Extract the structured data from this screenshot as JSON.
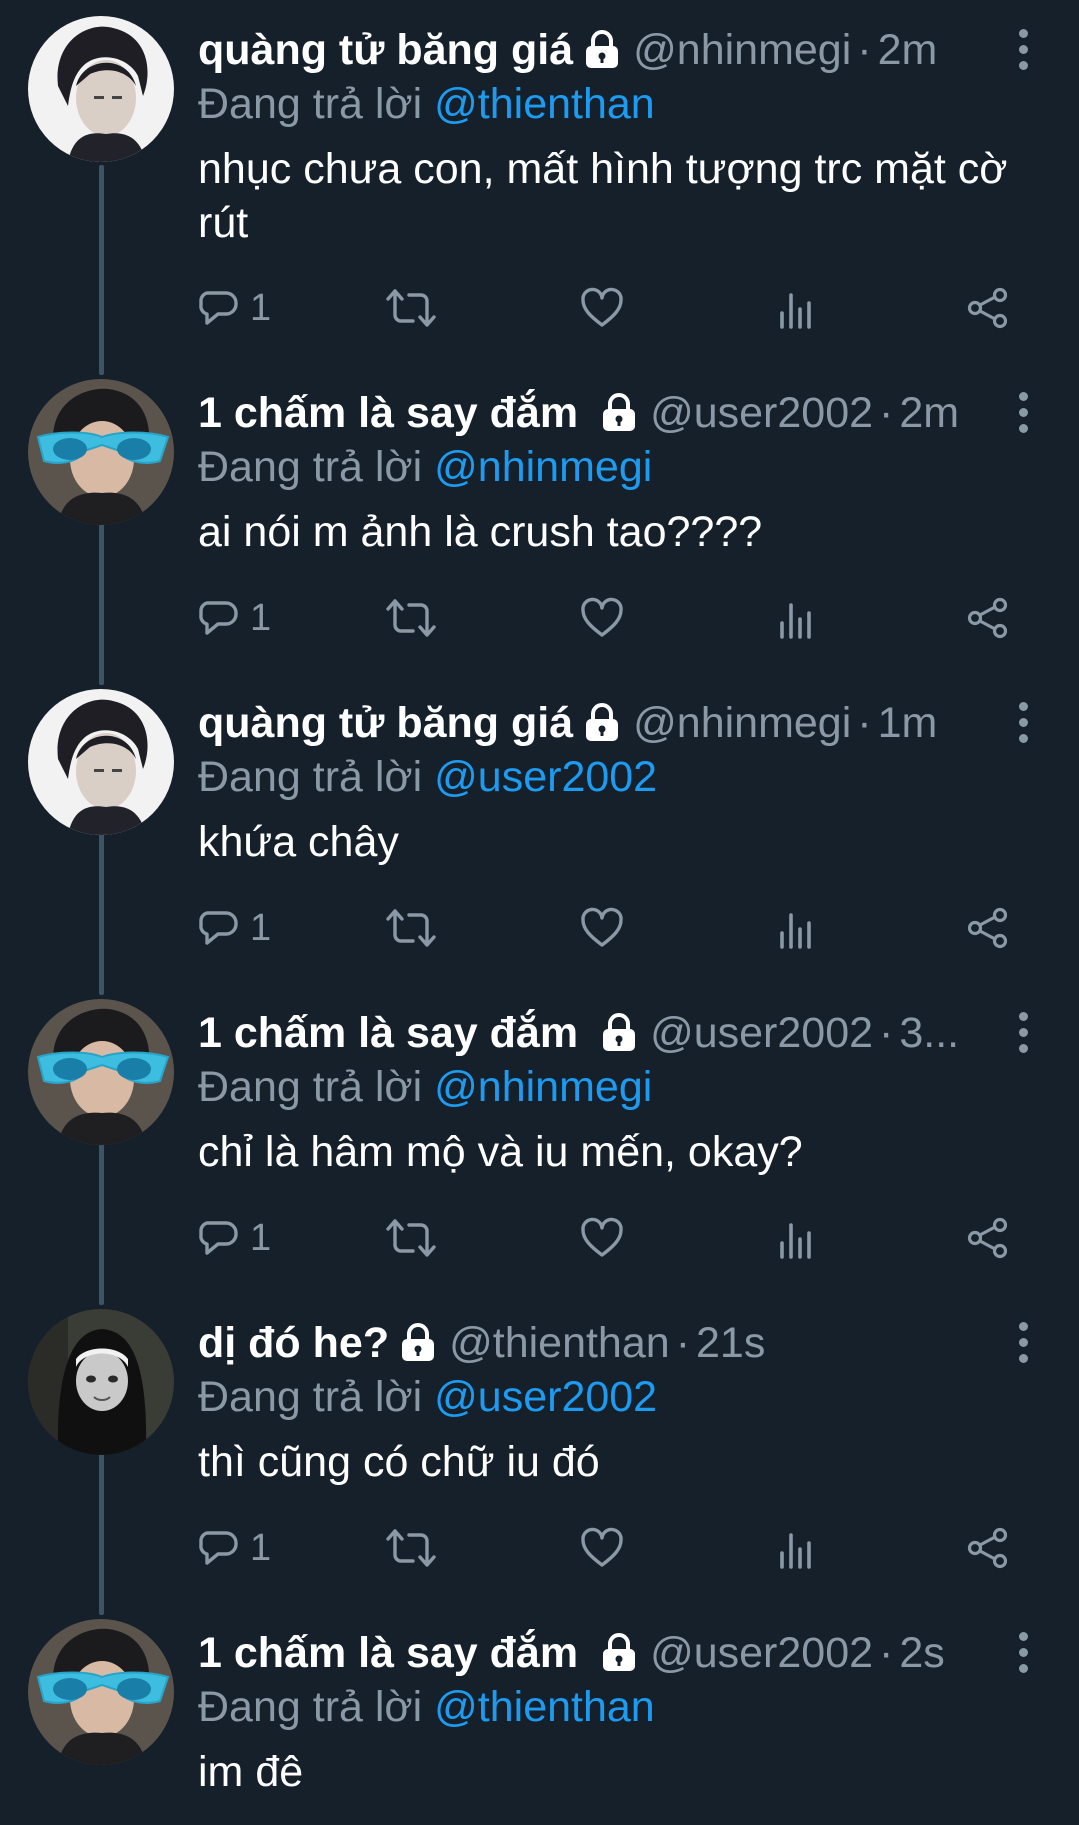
{
  "tweets": [
    {
      "name": "quàng tử băng giá",
      "handle": "@nhinmegi",
      "time": "2m",
      "reply_prefix": "Đang trả lời",
      "reply_to": "@thienthan",
      "text": "nhục chưa con, mất hình tượng trc mặt cờ rút",
      "reply_count": "1",
      "avatar": "avatar-nhinmegi"
    },
    {
      "name": "1 chấm là say đắm",
      "handle": "@user2002",
      "time": "2m",
      "reply_prefix": "Đang trả lời",
      "reply_to": "@nhinmegi",
      "text": "ai nói m ảnh là crush tao????",
      "reply_count": "1",
      "avatar": "avatar-user2002"
    },
    {
      "name": "quàng tử băng giá",
      "handle": "@nhinmegi",
      "time": "1m",
      "reply_prefix": "Đang trả lời",
      "reply_to": "@user2002",
      "text": "khứa chây",
      "reply_count": "1",
      "avatar": "avatar-nhinmegi"
    },
    {
      "name": "1 chấm là say đắm",
      "handle": "@user2002",
      "time": "3...",
      "reply_prefix": "Đang trả lời",
      "reply_to": "@nhinmegi",
      "text": "chỉ là hâm mộ và iu mến, okay?",
      "reply_count": "1",
      "avatar": "avatar-user2002"
    },
    {
      "name": "dị đó he?",
      "handle": "@thienthan",
      "time": "21s",
      "reply_prefix": "Đang trả lời",
      "reply_to": "@user2002",
      "text": "thì cũng có chữ iu đó",
      "reply_count": "1",
      "avatar": "avatar-thienthan"
    },
    {
      "name": "1 chấm là say đắm",
      "handle": "@user2002",
      "time": "2s",
      "reply_prefix": "Đang trả lời",
      "reply_to": "@thienthan",
      "text": "im đê",
      "reply_count": "",
      "avatar": "avatar-user2002"
    }
  ],
  "icons": {
    "lock": "lock-icon",
    "reply": "reply-icon",
    "retweet": "retweet-icon",
    "like": "heart-icon",
    "views": "views-icon",
    "share": "share-icon",
    "more": "more-icon"
  },
  "colors": {
    "background": "#15202b",
    "secondary_text": "#8b98a5",
    "link": "#1d9bf0",
    "thread_line": "#3d5466"
  }
}
